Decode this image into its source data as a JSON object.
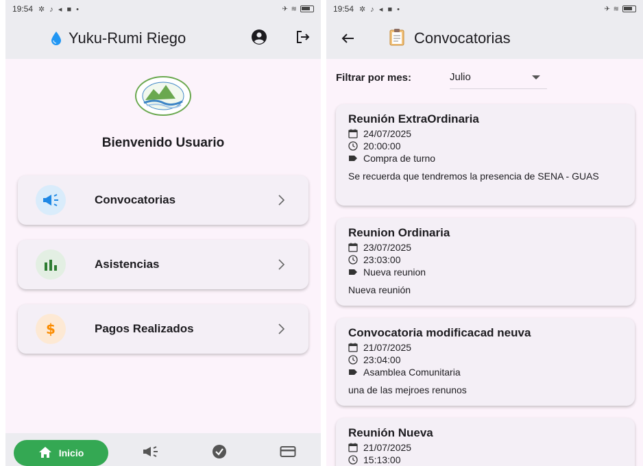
{
  "left": {
    "status": {
      "time": "19:54"
    },
    "appbar": {
      "title": "Yuku-Rumi Riego"
    },
    "welcome": "Bienvenido Usuario",
    "menu": [
      {
        "label": "Convocatorias",
        "icon": "megaphone-icon"
      },
      {
        "label": "Asistencias",
        "icon": "bar-chart-icon"
      },
      {
        "label": "Pagos Realizados",
        "icon": "dollar-icon"
      }
    ],
    "bottomnav": {
      "home_label": "Inicio"
    }
  },
  "right": {
    "status": {
      "time": "19:54"
    },
    "appbar": {
      "title": "Convocatorias"
    },
    "filter": {
      "label": "Filtrar por mes:",
      "value": "Julio"
    },
    "cards": [
      {
        "title": "Reunión ExtraOrdinaria",
        "date": "24/07/2025",
        "time": "20:00:00",
        "tag": "Compra de turno",
        "description": "Se recuerda que tendremos la presencia de SENA - GUAS"
      },
      {
        "title": "Reunion Ordinaria",
        "date": "23/07/2025",
        "time": "23:03:00",
        "tag": "Nueva reunion",
        "description": "Nueva reunión"
      },
      {
        "title": "Convocatoria modificacad neuva",
        "date": "21/07/2025",
        "time": "23:04:00",
        "tag": "Asamblea Comunitaria",
        "description": "una de las mejroes renunos"
      },
      {
        "title": "Reunión Nueva",
        "date": "21/07/2025",
        "time": "15:13:00",
        "tag": "",
        "description": ""
      }
    ]
  },
  "colors": {
    "background": "#fcf3fb",
    "appbar": "#ececf0",
    "card": "#f4eff6",
    "home_active": "#34a853",
    "megaphone_blue": "#1e88e5",
    "chart_green": "#2e7d32",
    "dollar_orange": "#fb8c00"
  }
}
